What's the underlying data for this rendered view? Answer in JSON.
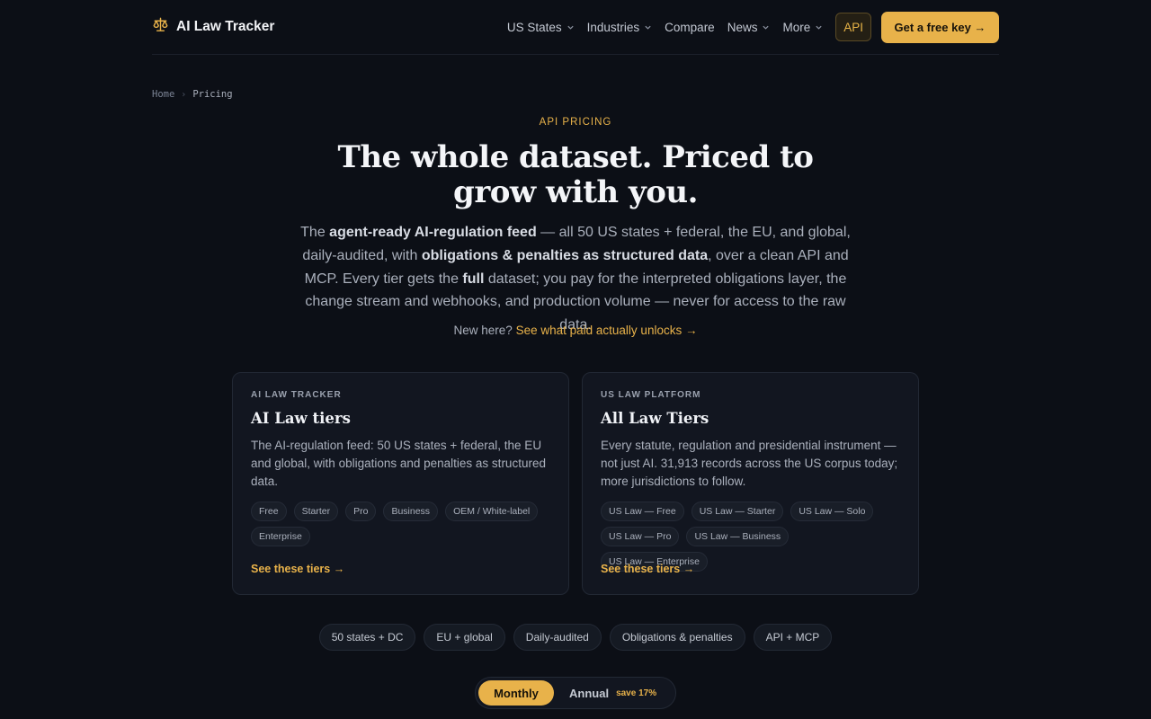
{
  "brand": {
    "name": "AI Law Tracker",
    "icon": "scales-icon"
  },
  "nav": {
    "items": [
      {
        "label": "US States",
        "has_dropdown": true
      },
      {
        "label": "Industries",
        "has_dropdown": true
      },
      {
        "label": "Compare",
        "has_dropdown": false
      },
      {
        "label": "News",
        "has_dropdown": true
      },
      {
        "label": "More",
        "has_dropdown": true
      }
    ],
    "api_label": "API",
    "cta_label": "Get a free key →"
  },
  "breadcrumb": {
    "home": "Home",
    "separator": "›",
    "current": "Pricing"
  },
  "hero": {
    "eyebrow": "API PRICING",
    "title": "The whole dataset. Priced to grow with you.",
    "desc": {
      "p1": "The ",
      "b1": "agent-ready AI-regulation feed",
      "p2": " — all 50 US states + federal, the EU, and global, daily-audited, with ",
      "b2": "obligations & penalties as structured data",
      "p3": ", over a clean API and MCP. Every tier gets the ",
      "b3": "full",
      "p4": " dataset; you pay for the interpreted obligations layer, the change stream and webhooks, and production volume — never for access to the raw data."
    },
    "new_here": "New here?",
    "new_here_link": "See what paid actually unlocks →"
  },
  "cards": [
    {
      "eyebrow": "AI LAW TRACKER",
      "title": "AI Law tiers",
      "desc": "The AI-regulation feed: 50 US states + federal, the EU and global, with obligations and penalties as structured data.",
      "chips": [
        "Free",
        "Starter",
        "Pro",
        "Business",
        "OEM / White-label",
        "Enterprise"
      ],
      "link": "See these tiers →"
    },
    {
      "eyebrow": "US LAW PLATFORM",
      "title": "All Law Tiers",
      "desc": "Every statute, regulation and presidential instrument — not just AI. 31,913 records across the US corpus today; more jurisdictions to follow.",
      "chips": [
        "US Law — Free",
        "US Law — Starter",
        "US Law — Solo",
        "US Law — Pro",
        "US Law — Business",
        "US Law — Enterprise"
      ],
      "link": "See these tiers →"
    }
  ],
  "features": [
    "50 states + DC",
    "EU + global",
    "Daily-audited",
    "Obligations & penalties",
    "API + MCP"
  ],
  "billing": {
    "monthly": "Monthly",
    "annual": "Annual",
    "save": "save 17%",
    "selected": "Monthly"
  },
  "colors": {
    "accent": "#e8b24a",
    "background": "#0c0f16",
    "card": "#121620"
  }
}
